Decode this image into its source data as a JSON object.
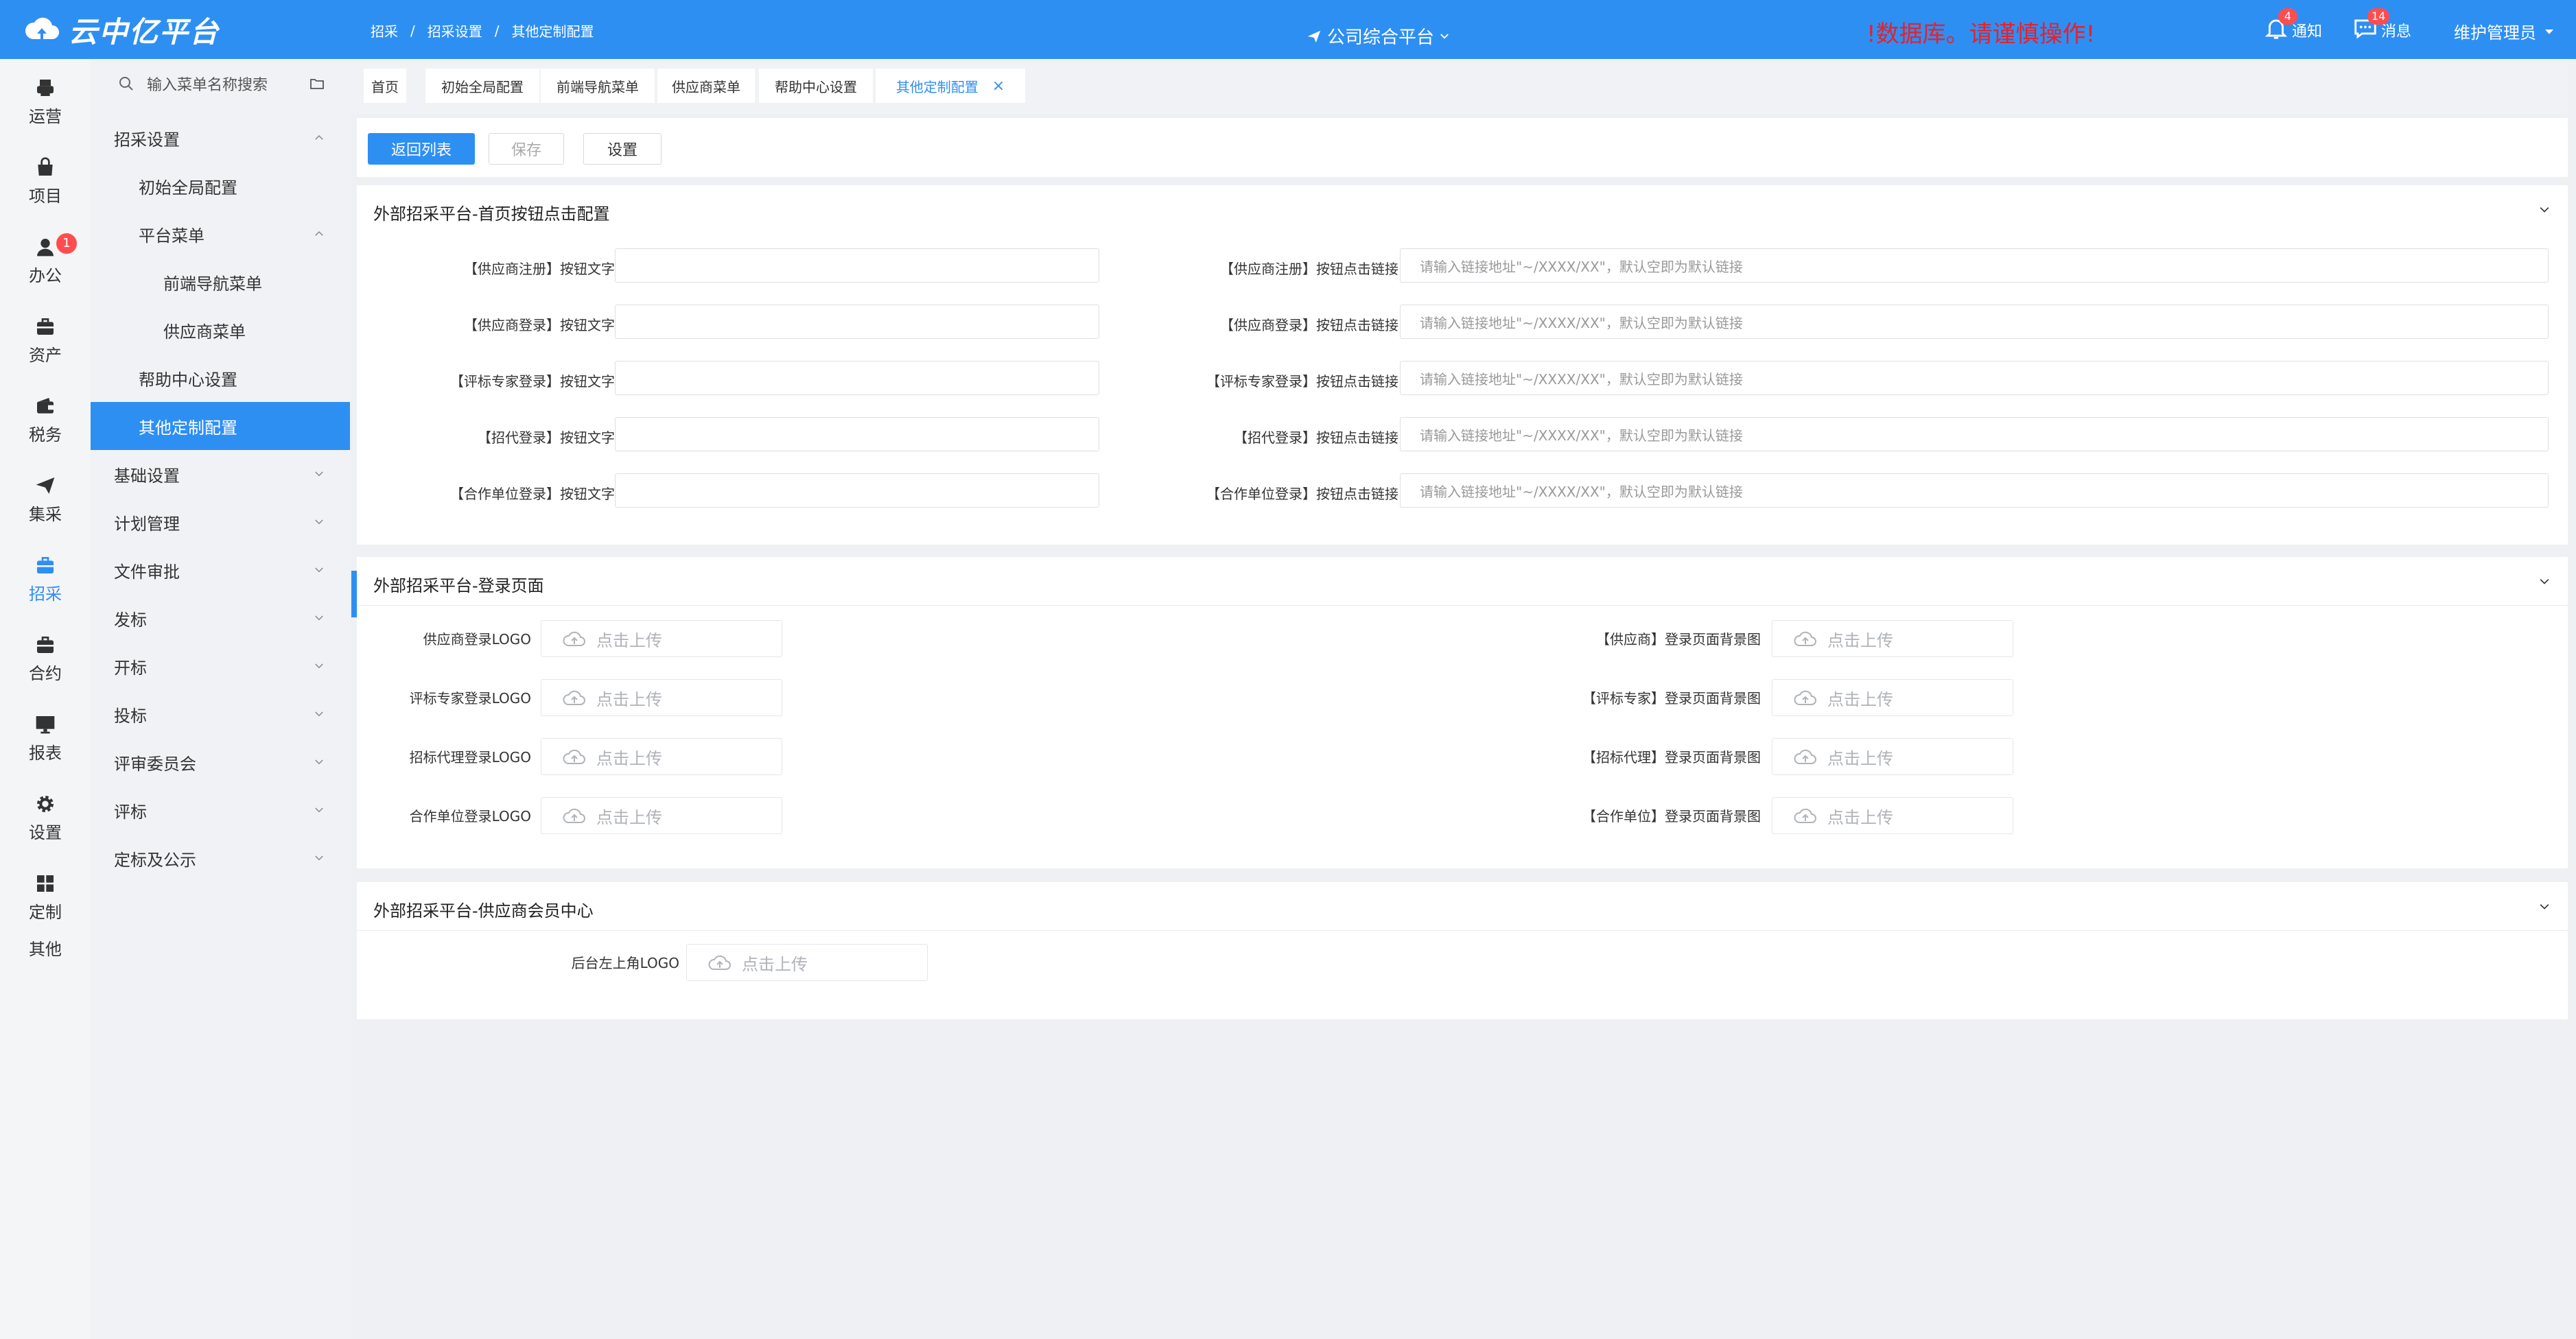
{
  "header": {
    "logo_text": "云中亿平台",
    "breadcrumb": [
      "招采",
      "招采设置",
      "其他定制配置"
    ],
    "breadcrumb_sep": "/",
    "platform": "公司综合平台",
    "warning": "!数据库。请谨慎操作!",
    "notify": {
      "label": "通知",
      "badge": "4"
    },
    "message": {
      "label": "消息",
      "badge": "14"
    },
    "user": "维护管理员"
  },
  "rail": [
    {
      "label": "运营",
      "icon": "printer-icon"
    },
    {
      "label": "项目",
      "icon": "bag-icon"
    },
    {
      "label": "办公",
      "icon": "person-icon",
      "badge": "1"
    },
    {
      "label": "资产",
      "icon": "briefcase-icon"
    },
    {
      "label": "税务",
      "icon": "wallet-icon"
    },
    {
      "label": "集采",
      "icon": "send-icon"
    },
    {
      "label": "招采",
      "icon": "case-icon",
      "active": true
    },
    {
      "label": "合约",
      "icon": "case-icon"
    },
    {
      "label": "报表",
      "icon": "monitor-icon"
    },
    {
      "label": "设置",
      "icon": "gear-icon"
    },
    {
      "label": "定制",
      "icon": "grid-icon"
    },
    {
      "label": "其他",
      "icon": ""
    }
  ],
  "sidebar": {
    "search_placeholder": "输入菜单名称搜索",
    "items": [
      {
        "label": "招采设置",
        "level": 1,
        "chev": "up"
      },
      {
        "label": "初始全局配置",
        "level": 2
      },
      {
        "label": "平台菜单",
        "level": 2,
        "chev": "up"
      },
      {
        "label": "前端导航菜单",
        "level": 3
      },
      {
        "label": "供应商菜单",
        "level": 3
      },
      {
        "label": "帮助中心设置",
        "level": 2
      },
      {
        "label": "其他定制配置",
        "level": 2,
        "active": true
      },
      {
        "label": "基础设置",
        "level": 1,
        "chev": "down"
      },
      {
        "label": "计划管理",
        "level": 1,
        "chev": "down"
      },
      {
        "label": "文件审批",
        "level": 1,
        "chev": "down"
      },
      {
        "label": "发标",
        "level": 1,
        "chev": "down"
      },
      {
        "label": "开标",
        "level": 1,
        "chev": "down"
      },
      {
        "label": "投标",
        "level": 1,
        "chev": "down"
      },
      {
        "label": "评审委员会",
        "level": 1,
        "chev": "down"
      },
      {
        "label": "评标",
        "level": 1,
        "chev": "down"
      },
      {
        "label": "定标及公示",
        "level": 1,
        "chev": "down"
      }
    ]
  },
  "tabs": [
    {
      "label": "首页"
    },
    {
      "label": "初始全局配置"
    },
    {
      "label": "前端导航菜单"
    },
    {
      "label": "供应商菜单"
    },
    {
      "label": "帮助中心设置"
    },
    {
      "label": "其他定制配置",
      "active": true,
      "close": "×"
    }
  ],
  "toolbar": {
    "back": "返回列表",
    "save": "保存",
    "settings": "设置"
  },
  "section1": {
    "title": "外部招采平台-首页按钮点击配置",
    "link_placeholder": "请输入链接地址\"~/XXXX/XX\"，默认空即为默认链接",
    "rows": [
      {
        "text_label": "【供应商注册】按钮文字",
        "link_label": "【供应商注册】按钮点击链接"
      },
      {
        "text_label": "【供应商登录】按钮文字",
        "link_label": "【供应商登录】按钮点击链接"
      },
      {
        "text_label": "【评标专家登录】按钮文字",
        "link_label": "【评标专家登录】按钮点击链接"
      },
      {
        "text_label": "【招代登录】按钮文字",
        "link_label": "【招代登录】按钮点击链接"
      },
      {
        "text_label": "【合作单位登录】按钮文字",
        "link_label": "【合作单位登录】按钮点击链接"
      }
    ]
  },
  "section2": {
    "title": "外部招采平台-登录页面",
    "upload_text": "点击上传",
    "rows": [
      {
        "left": "供应商登录LOGO",
        "right": "【供应商】登录页面背景图"
      },
      {
        "left": "评标专家登录LOGO",
        "right": "【评标专家】登录页面背景图"
      },
      {
        "left": "招标代理登录LOGO",
        "right": "【招标代理】登录页面背景图"
      },
      {
        "left": "合作单位登录LOGO",
        "right": "【合作单位】登录页面背景图"
      }
    ]
  },
  "section3": {
    "title": "外部招采平台-供应商会员中心",
    "upload_text": "点击上传",
    "label": "后台左上角LOGO"
  }
}
